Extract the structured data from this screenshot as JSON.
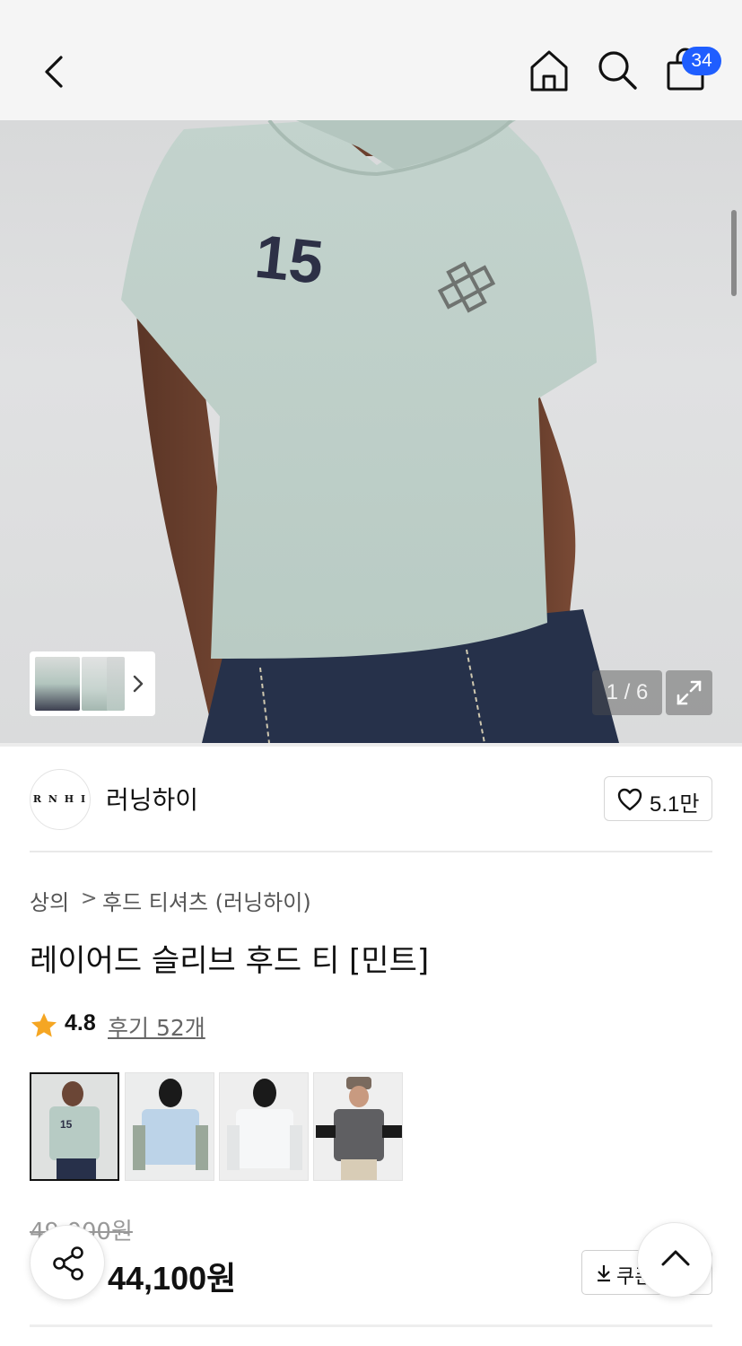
{
  "header": {
    "cart_count": "34"
  },
  "gallery": {
    "counter": "1 / 6"
  },
  "brand": {
    "logo_text": "R N H I",
    "name": "러닝하이",
    "likes": "5.1만"
  },
  "breadcrumb": {
    "category": "상의",
    "separator": ">",
    "subcategory": "후드 티셔츠 (러닝하이)"
  },
  "product": {
    "title": "레이어드 슬리브 후드 티 [민트]",
    "rating": "4.8",
    "reviews": "후기 52개",
    "original_price": "49,000원",
    "price": "44,100원",
    "coupon_label": "쿠폰"
  },
  "colors": {
    "mint": "#b7cbc4",
    "sky": "#bcd3e8",
    "white": "#eef0f2",
    "charcoal": "#5f5f62",
    "accent_badge": "#1f5eff",
    "star": "#f5a623"
  },
  "icons": [
    "back-icon",
    "home-icon",
    "search-icon",
    "cart-icon",
    "expand-icon",
    "heart-icon",
    "star-icon",
    "share-icon",
    "download-icon",
    "chevron-up-icon"
  ]
}
